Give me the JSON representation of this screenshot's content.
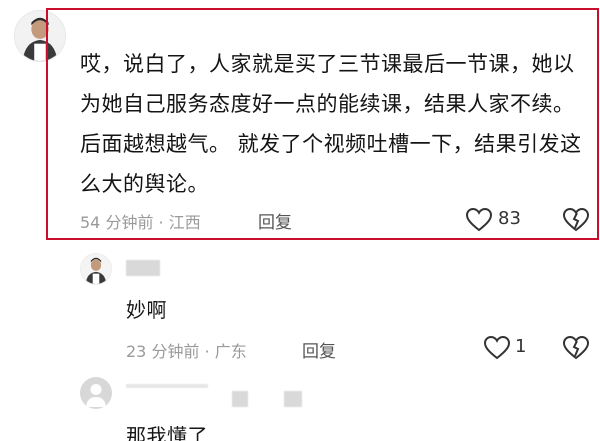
{
  "main_comment": {
    "text": "哎，说白了，人家就是买了三节课最后一节课，她以为她自己服务态度好一点的能续课，结果人家不续。后面越想越气。 就发了个视频吐槽一下，结果引发这么大的舆论。",
    "meta": "54 分钟前 · 江西",
    "reply_label": "回复",
    "like_count": "83"
  },
  "replies": [
    {
      "text": "妙啊",
      "meta": "23 分钟前 · 广东",
      "reply_label": "回复",
      "like_count": "1"
    },
    {
      "text": "那我懂了"
    }
  ],
  "colors": {
    "highlight_border": "#c8102e",
    "meta_text": "#9a9a9a"
  },
  "icons": [
    "avatar",
    "heart-icon",
    "dislike-heart-icon"
  ]
}
